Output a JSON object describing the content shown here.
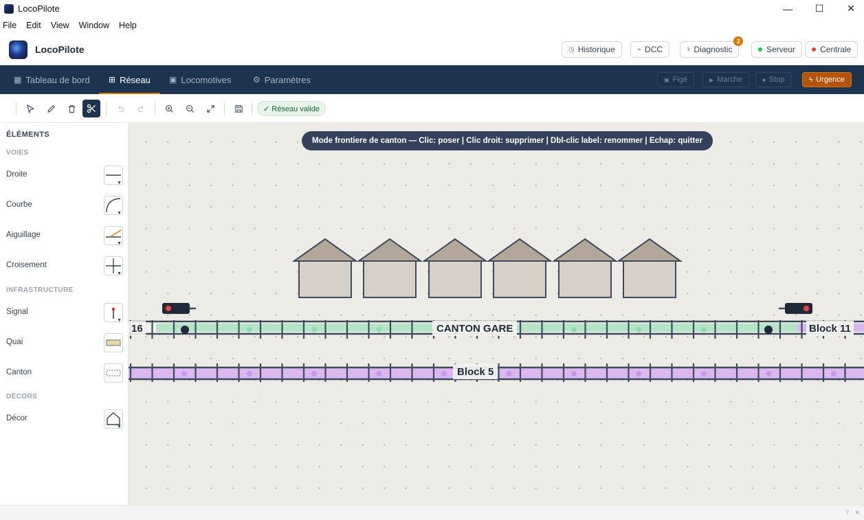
{
  "window": {
    "title": "LocoPilote",
    "minimize": "—",
    "maximize": "☐",
    "close": "✕"
  },
  "menu": [
    "File",
    "Edit",
    "View",
    "Window",
    "Help"
  ],
  "header": {
    "brand": "LocoPilote",
    "buttons": {
      "historique": "Historique",
      "dcc": "DCC",
      "diagnostic": "Diagnostic",
      "diagnostic_badge": "2",
      "serveur": "Serveur",
      "centrale": "Centrale"
    },
    "status_colors": {
      "serveur": "#22c55e",
      "centrale": "#ef4444"
    }
  },
  "nav": {
    "tabs": [
      "Tableau de bord",
      "Réseau",
      "Locomotives",
      "Paramètres"
    ],
    "active": "Réseau",
    "controls": {
      "fige": "Figé",
      "marche": "Marche",
      "stop": "Stop",
      "urgence": "Urgence"
    }
  },
  "toolbar": {
    "tools": [
      "select-icon",
      "pencil-icon",
      "trash-icon",
      "scissors-icon",
      "undo-icon",
      "redo-icon",
      "zoom-in-icon",
      "zoom-out-icon",
      "fit-icon",
      "save-icon"
    ],
    "active_tool": "scissors-icon",
    "status": "✓ Réseau valide"
  },
  "sidebar": {
    "title": "ÉLÉMENTS",
    "sections": [
      {
        "name": "VOIES",
        "items": [
          "Droite",
          "Courbe",
          "Aiguillage",
          "Croisement"
        ]
      },
      {
        "name": "INFRASTRUCTURE",
        "items": [
          "Signal",
          "Quai",
          "Canton"
        ]
      },
      {
        "name": "DÉCORS",
        "items": [
          "Décor"
        ]
      }
    ]
  },
  "canvas": {
    "hint": "Mode frontiere de canton — Clic: poser | Clic droit: supprimer | Dbl-clic label: renommer | Echap: quitter",
    "labels": {
      "left_block": "16",
      "station": "CANTON GARE",
      "right_block": "Block 11",
      "lower_block": "Block 5"
    },
    "colors": {
      "track_green": "#b7e4c7",
      "track_purple": "#d9b8f0",
      "tie": "#3f4a5c",
      "house_roof": "#b3a897",
      "house_body": "#d6d0c8"
    }
  },
  "statusbar": {
    "help": "?",
    "close": "✕"
  }
}
